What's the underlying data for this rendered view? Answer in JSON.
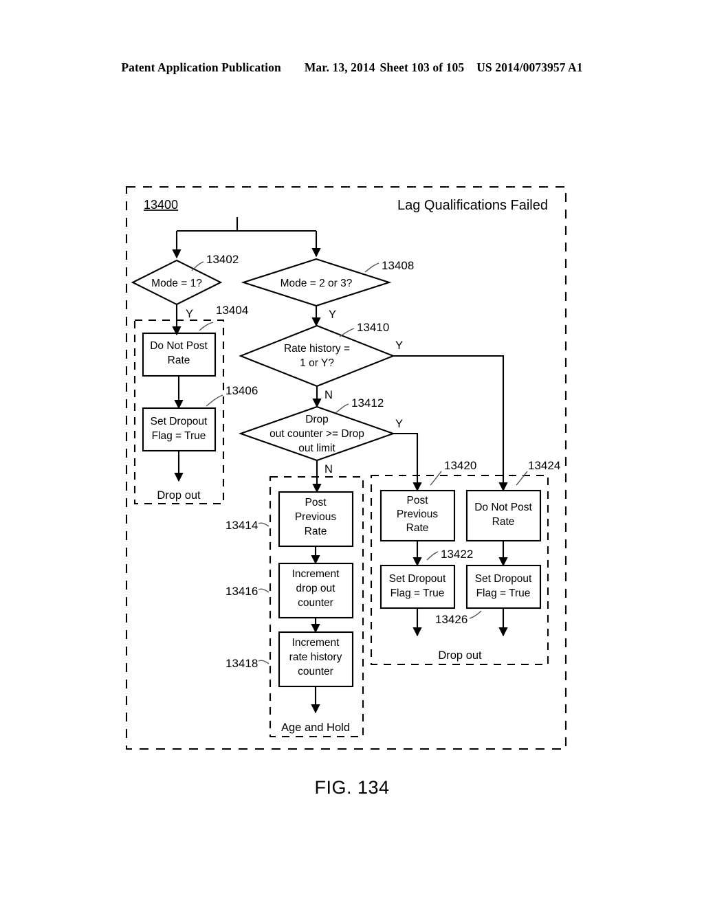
{
  "header": {
    "publication": "Patent Application Publication",
    "date": "Mar. 13, 2014",
    "sheet": "Sheet 103 of 105",
    "docnum": "US 2014/0073957 A1"
  },
  "figure": {
    "caption": "FIG. 134",
    "diagram_id": "13400",
    "title": "Lag Qualifications Failed"
  },
  "groups": {
    "left_dropout": "Drop out",
    "age_and_hold": "Age and Hold",
    "right_dropout": "Drop out"
  },
  "nodes": {
    "n13402": {
      "ref": "13402",
      "text": "Mode = 1?"
    },
    "n13408": {
      "ref": "13408",
      "text": "Mode = 2 or 3?"
    },
    "n13410": {
      "ref": "13410",
      "line1": "Rate history =",
      "line2": "1 or Y?"
    },
    "n13412": {
      "ref": "13412",
      "line1": "Drop",
      "line2": "out counter >= Drop",
      "line3": "out limit"
    },
    "n13404": {
      "ref": "13404",
      "line1": "Do Not Post",
      "line2": "Rate"
    },
    "n13406": {
      "ref": "13406",
      "line1": "Set Dropout",
      "line2": "Flag = True"
    },
    "n13414": {
      "ref": "13414",
      "line1": "Post",
      "line2": "Previous",
      "line3": "Rate"
    },
    "n13416": {
      "ref": "13416",
      "line1": "Increment",
      "line2": "drop out",
      "line3": "counter"
    },
    "n13418": {
      "ref": "13418",
      "line1": "Increment",
      "line2": "rate history",
      "line3": "counter"
    },
    "n13420": {
      "ref": "13420",
      "line1": "Post",
      "line2": "Previous",
      "line3": "Rate"
    },
    "n13422": {
      "ref": "13422",
      "line1": "Set Dropout",
      "line2": "Flag = True"
    },
    "n13424": {
      "ref": "13424",
      "line1": "Do Not Post",
      "line2": "Rate"
    },
    "n13426": {
      "ref": "13426",
      "line1": "Set Dropout",
      "line2": "Flag = True"
    }
  },
  "edge_labels": {
    "mode1_yes": "Y",
    "mode23_yes": "Y",
    "ratehist_yes": "Y",
    "ratehist_no": "N",
    "dropcnt_yes": "Y",
    "dropcnt_no": "N"
  },
  "colors": {
    "ink": "#000000",
    "paper": "#ffffff"
  }
}
